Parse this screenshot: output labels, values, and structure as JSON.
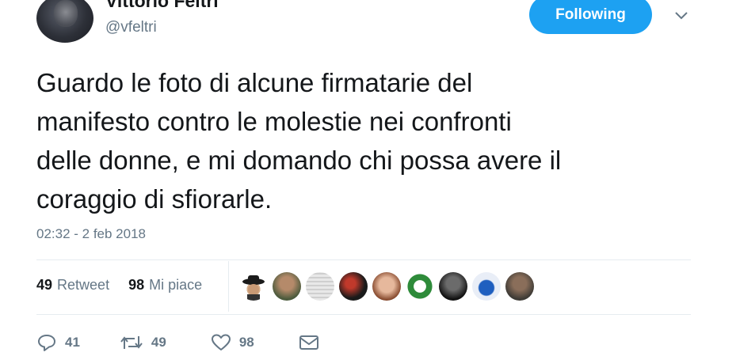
{
  "user": {
    "display_name": "Vittorio Feltri",
    "handle": "@vfeltri",
    "follow_label": "Following"
  },
  "tweet": {
    "lines": [
      "Guardo le foto di alcune firmatarie del",
      "manifesto contro le molestie nei confronti",
      "delle donne, e mi domando chi possa avere il",
      "coraggio di sfiorarle."
    ],
    "timestamp": "02:32 - 2 feb 2018"
  },
  "stats": {
    "retweets_count": "49",
    "retweets_label": "Retweet",
    "likes_count": "98",
    "likes_label": "Mi piace"
  },
  "actions": {
    "reply_count": "41",
    "retweet_count": "49",
    "like_count": "98"
  },
  "colors": {
    "accent": "#1da1f2",
    "secondary_text": "#657786",
    "divider": "#e6ecf0"
  }
}
